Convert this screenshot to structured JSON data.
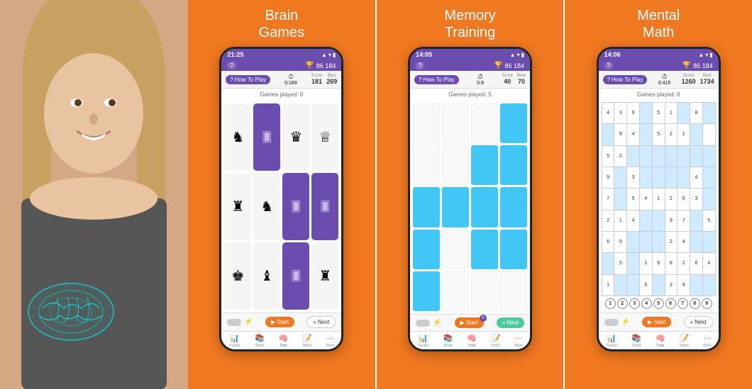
{
  "panels": [
    {
      "title": "Brain\nGames",
      "phone": {
        "time": "21:25",
        "score_display": "86 184",
        "timer": "0:169",
        "score": "181",
        "best": "269",
        "games_played": "Games played: 0",
        "start_label": "▶ Start",
        "next_label": "» Next",
        "next_style": "plain"
      }
    },
    {
      "title": "Memory\nTraining",
      "phone": {
        "time": "14:05",
        "score_display": "86 184",
        "timer": "0:9",
        "score": "40",
        "best": "70",
        "games_played": "Games played: 5",
        "start_label": "▶ Start",
        "next_label": "» Next",
        "next_style": "teal",
        "badge": "5"
      }
    },
    {
      "title": "Mental\nMath",
      "phone": {
        "time": "14:06",
        "score_display": "86 184",
        "timer": "0:415",
        "score": "1260",
        "best": "1734",
        "games_played": "Games played: 0",
        "start_label": "▶ Start",
        "next_label": "» Next",
        "next_style": "plain"
      }
    }
  ],
  "nav_tabs": [
    "Tracker",
    "Read",
    "Train",
    "Notes",
    "More"
  ],
  "nav_icons": [
    "📊",
    "📚",
    "🧠",
    "📝",
    "⋯"
  ],
  "chess_pieces": [
    "♞",
    "card",
    "♛",
    "♕",
    "♜",
    "♞",
    "card",
    "card",
    "♚",
    "♝",
    "card",
    "♜"
  ],
  "memory_pattern": [
    [
      0,
      0,
      0,
      1
    ],
    [
      0,
      0,
      1,
      1
    ],
    [
      1,
      1,
      1,
      1
    ],
    [
      1,
      0,
      1,
      1
    ],
    [
      1,
      0,
      0,
      0
    ]
  ],
  "sudoku": {
    "rows": [
      [
        "4",
        "3",
        "9",
        "",
        "5",
        "1",
        "",
        "8",
        ""
      ],
      [
        "",
        "9",
        "4",
        "",
        "5",
        "2",
        "1",
        "",
        ""
      ],
      [
        "5",
        "2",
        "",
        "",
        "",
        "",
        "",
        "",
        ""
      ],
      [
        "9",
        "",
        "3",
        "",
        "",
        "",
        "",
        "4",
        ""
      ],
      [
        "7",
        "",
        "5",
        "4",
        "1",
        "2",
        "6",
        "3",
        ""
      ],
      [
        "2",
        "1",
        "4",
        "",
        "",
        "9",
        "7",
        "",
        "5"
      ],
      [
        "6",
        "9",
        "",
        "",
        "",
        "2",
        "4",
        "",
        ""
      ],
      [
        "",
        "5",
        "",
        "1",
        "9",
        "8",
        "2",
        "6",
        "4"
      ],
      [
        "1",
        "",
        "",
        "6",
        "",
        "3",
        "9",
        "",
        ""
      ]
    ],
    "highlights": [
      [
        0,
        3
      ],
      [
        0,
        6
      ],
      [
        0,
        8
      ],
      [
        1,
        0
      ],
      [
        1,
        3
      ],
      [
        1,
        7
      ],
      [
        2,
        3
      ],
      [
        2,
        4
      ],
      [
        2,
        5
      ],
      [
        2,
        6
      ],
      [
        2,
        7
      ],
      [
        2,
        8
      ],
      [
        3,
        1
      ],
      [
        3,
        3
      ],
      [
        3,
        4
      ],
      [
        3,
        5
      ],
      [
        3,
        6
      ],
      [
        3,
        8
      ],
      [
        4,
        1
      ],
      [
        4,
        8
      ],
      [
        5,
        3
      ],
      [
        5,
        4
      ],
      [
        5,
        7
      ],
      [
        6,
        3
      ],
      [
        6,
        4
      ],
      [
        6,
        7
      ],
      [
        7,
        0
      ],
      [
        7,
        2
      ],
      [
        8,
        1
      ],
      [
        8,
        2
      ],
      [
        8,
        4
      ],
      [
        8,
        7
      ],
      [
        8,
        8
      ]
    ]
  },
  "number_row": [
    "1",
    "2",
    "3",
    "4",
    "5",
    "6",
    "7",
    "8",
    "9"
  ]
}
